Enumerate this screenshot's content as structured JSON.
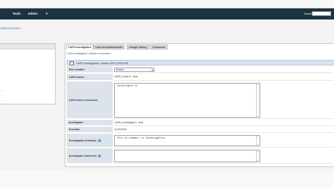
{
  "nav": {
    "items": [
      {
        "label": "Tools"
      },
      {
        "label": "Admin"
      }
    ],
    "search_label": "Search"
  },
  "breadcrumb": "CAPA-2015-001 ›",
  "left": {
    "items": [
      "...",
      "...",
      "..."
    ]
  },
  "tabs": [
    {
      "label": "CAPA Investigation",
      "active": true
    },
    {
      "label": "Links and Attachments"
    },
    {
      "label": "Change History"
    },
    {
      "label": "Comments"
    }
  ],
  "subnav": {
    "primary": "CAPA Investigation",
    "secondary": "System Information"
  },
  "section_title": "CAPA Investigation: Boston-BIO-2015-004",
  "form": {
    "site_location": {
      "label": "Site Location",
      "value": "Boston"
    },
    "capa_owner": {
      "label": "CAPA Owner",
      "value": "CAPA_Owner1, Jane"
    },
    "capa_owner_comments": {
      "label": "CAPA Owner Comments",
      "value": "Investigate it"
    },
    "investigator": {
      "label": "Investigator",
      "value": "CAPA_Investigator1, Jane"
    },
    "due_date": {
      "label": "Due Date",
      "value": "11/20/2015"
    },
    "investigation_summary": {
      "label": "Investigation Summary",
      "value": "This is summary on investigation"
    },
    "investigator_comments": {
      "label": "Investigator Comments",
      "value": ""
    }
  }
}
